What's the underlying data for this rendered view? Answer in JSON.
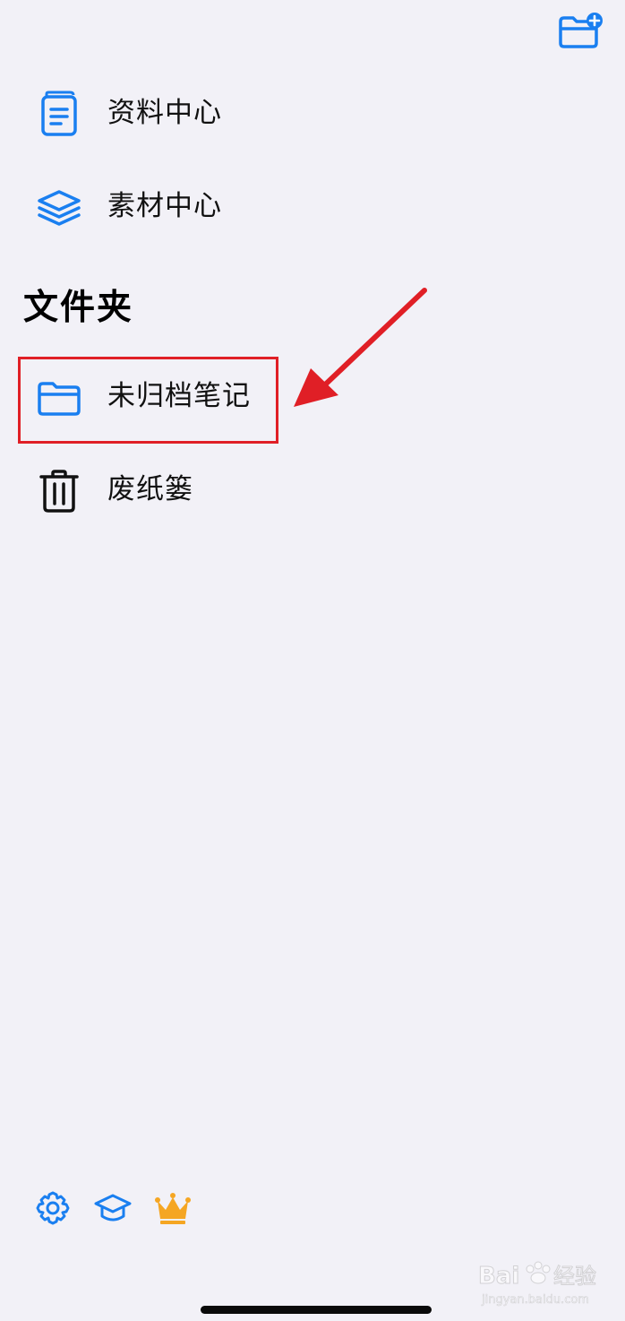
{
  "header": {
    "new_folder_icon": "folder-plus-icon"
  },
  "top_items": [
    {
      "label": "资料中心",
      "icon": "document-book-icon"
    },
    {
      "label": "素材中心",
      "icon": "layers-stack-icon"
    }
  ],
  "folders": {
    "title": "文件夹",
    "items": [
      {
        "label": "未归档笔记",
        "icon": "folder-icon"
      },
      {
        "label": "废纸篓",
        "icon": "trash-icon"
      }
    ]
  },
  "toolbar": {
    "icons": [
      "gear-icon",
      "graduation-cap-icon",
      "crown-icon"
    ]
  },
  "colors": {
    "accent": "#1a7ff0",
    "annotation": "#e01f26",
    "crown": "#f5a623",
    "background": "#f2f1f7"
  },
  "watermark": {
    "text": "Baidu经验",
    "subtext": "jingyan.baidu.com"
  }
}
